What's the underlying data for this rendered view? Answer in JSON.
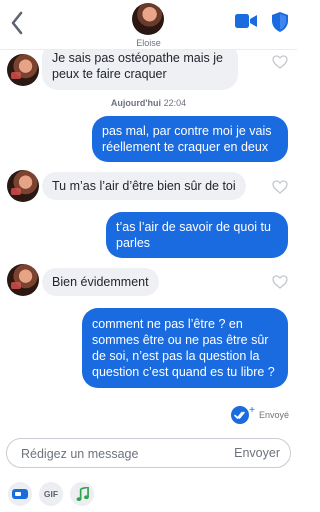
{
  "header": {
    "contact_name": "Eloise"
  },
  "thread": {
    "timestamp_day": "Aujourd'hui",
    "timestamp_time": "22:04",
    "messages": [
      {
        "from": "them",
        "text": "Je sais pas ostéopathe mais je peux te faire craquer"
      },
      {
        "from": "me",
        "text": "pas mal, par contre moi je vais réellement te craquer en deux"
      },
      {
        "from": "them",
        "text": "Tu m’as l’air d’être bien sûr de toi"
      },
      {
        "from": "me",
        "text": "t’as l’air de savoir de quoi tu parles"
      },
      {
        "from": "them",
        "text": "Bien évidemment"
      },
      {
        "from": "me",
        "text": "comment ne pas l’être ? en sommes être ou ne pas être sûr de soi, n’est pas la question la question c’est quand es tu libre ?"
      }
    ],
    "status": "Envoyé"
  },
  "composer": {
    "placeholder": "Rédigez un message",
    "send_label": "Envoyer"
  },
  "toolbar": {
    "gif_label": "GIF",
    "icons": [
      "sticker-icon",
      "gif-icon",
      "music-icon"
    ]
  },
  "colors": {
    "accent": "#1a6be0",
    "incoming_bubble": "#eff0f3",
    "muted_text": "#6d737c"
  }
}
